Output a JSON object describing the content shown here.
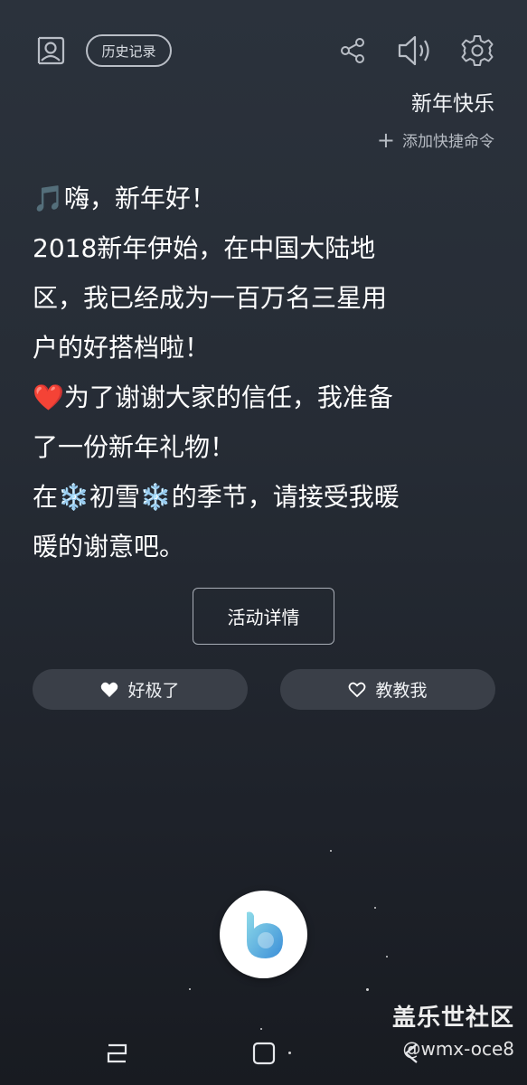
{
  "header": {
    "history_label": "历史记录",
    "icons": [
      "profile-icon",
      "share-icon",
      "volume-icon",
      "settings-icon"
    ]
  },
  "command": {
    "title": "新年快乐",
    "add_shortcut_label": "添加快捷命令"
  },
  "message": {
    "lines": [
      "🎵嗨，新年好！",
      "2018新年伊始，在中国大陆地",
      "区，我已经成为一百万名三星用",
      "户的好搭档啦！",
      "❤️为了谢谢大家的信任，我准备",
      "了一份新年礼物！",
      "在❄️初雪❄️的季节，请接受我暖",
      "暖的谢意吧。"
    ]
  },
  "actions": {
    "detail_label": "活动详情",
    "good_label": "好极了",
    "teach_label": "教教我"
  },
  "watermark": {
    "title": "盖乐世社区",
    "user": "@wmx-oce8"
  },
  "colors": {
    "background_top": "#2b323c",
    "background_bottom": "#181b21",
    "pill_bg": "#3a3f48",
    "bixby_gradient_start": "#7fd3e8",
    "bixby_gradient_end": "#3a8fd6"
  }
}
